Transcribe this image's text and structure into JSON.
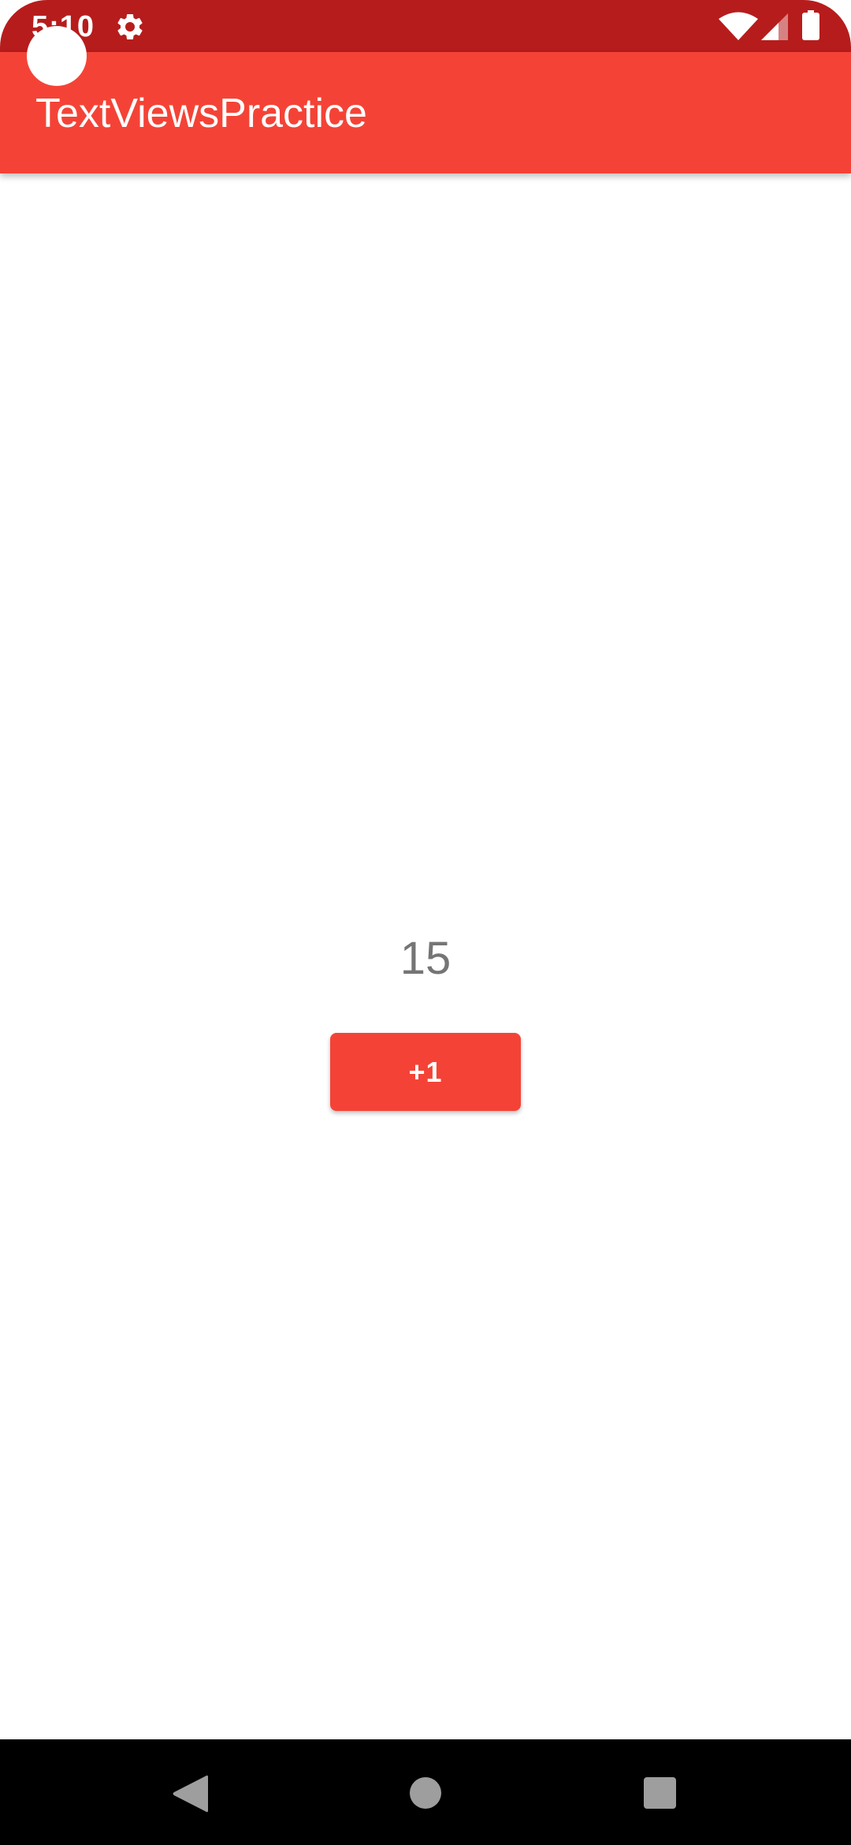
{
  "status_bar": {
    "time": "5:10",
    "icons": [
      "settings-gear-icon",
      "wifi-icon",
      "cell-signal-icon",
      "battery-icon"
    ],
    "background_color": "#b71c1c"
  },
  "app_bar": {
    "title": "TextViewsPractice",
    "background_color": "#f44336"
  },
  "main": {
    "counter_value": "15",
    "increment_button_label": "+1",
    "button_color": "#f44336",
    "counter_text_color": "#757575"
  },
  "navigation_bar": {
    "buttons": [
      "back-icon",
      "home-icon",
      "recents-icon"
    ]
  }
}
